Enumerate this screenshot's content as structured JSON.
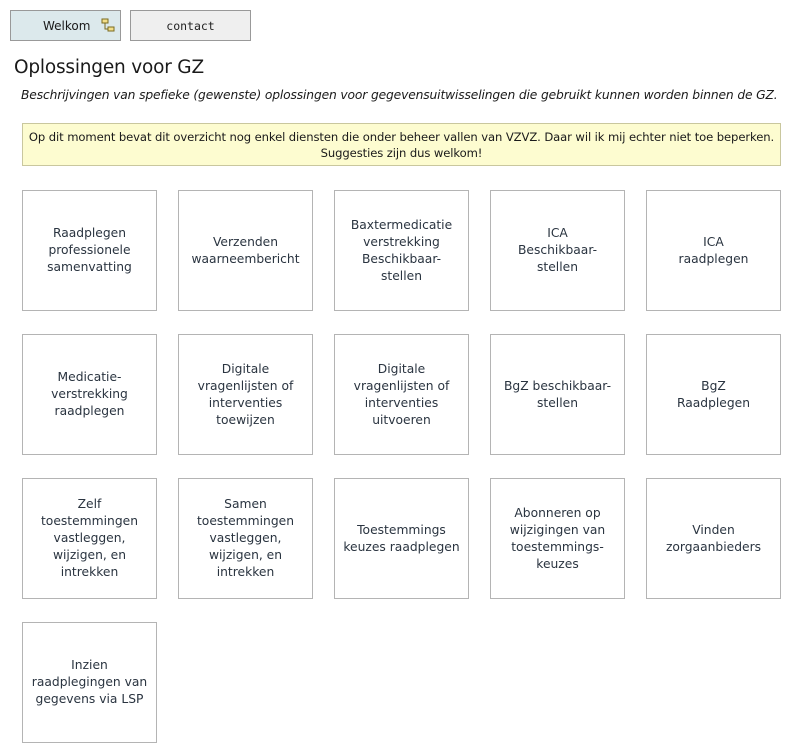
{
  "nav": {
    "tabs": [
      {
        "label": "Welkom",
        "icon": "sitemap-icon"
      },
      {
        "label": "contact"
      }
    ]
  },
  "page": {
    "title": "Oplossingen voor GZ",
    "subtitle": "Beschrijvingen van spefieke (gewenste) oplossingen voor gegevensuitwisselingen die gebruikt kunnen worden binnen de GZ.",
    "notice_line1": "Op dit moment bevat dit overzicht nog enkel diensten die onder beheer vallen van VZVZ. Daar wil ik mij echter niet toe beperken.",
    "notice_line2": "Suggesties zijn dus welkom!"
  },
  "cards": [
    "Raadplegen\nprofessionele\nsamenvatting",
    "Verzenden\nwaarneembericht",
    "Baxtermedicatie\nverstrekking\nBeschikbaar-\nstellen",
    "ICA\nBeschikbaar-\nstellen",
    "ICA\nraadplegen",
    "Medicatie-\nverstrekking\nraadplegen",
    "Digitale\nvragenlijsten of\ninterventies\ntoewijzen",
    "Digitale\nvragenlijsten of\ninterventies\nuitvoeren",
    "BgZ beschikbaar-\nstellen",
    "BgZ\nRaadplegen",
    "Zelf toestemmingen\nvastleggen,\nwijzigen, en\nintrekken",
    "Samen\ntoestemmingen\nvastleggen,\nwijzigen, en\nintrekken",
    "Toestemmings\nkeuzes raadplegen",
    "Abonneren op\nwijzigingen van\ntoestemmings-\nkeuzes",
    "Vinden\nzorgaanbieders",
    "Inzien\nraadplegingen van\ngegevens via LSP"
  ],
  "colors": {
    "active_tab": "#dce9ec",
    "inactive_tab": "#efefef",
    "notice_bg": "#fdfcd0",
    "card_border": "#b4b4b4"
  }
}
